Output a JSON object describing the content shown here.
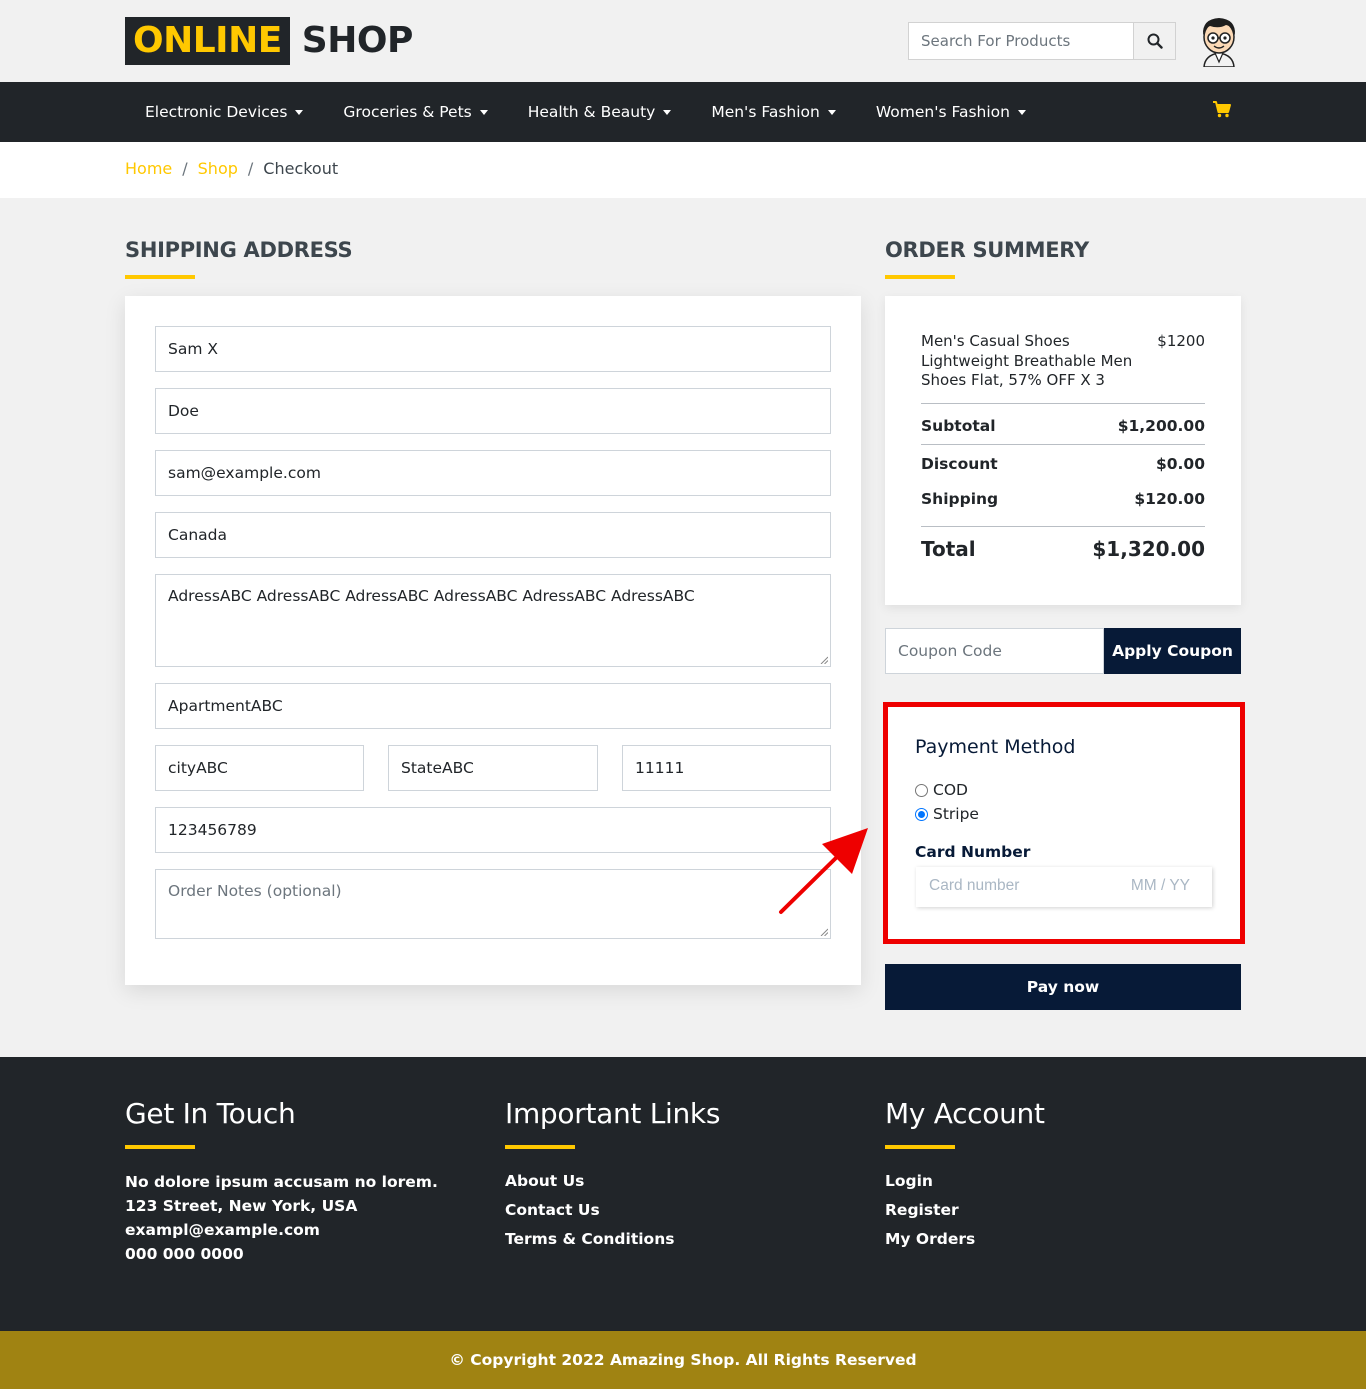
{
  "brand": {
    "part1": "ONLINE",
    "part2": "SHOP"
  },
  "search": {
    "placeholder": "Search For Products",
    "icon": "search-icon"
  },
  "nav": {
    "items": [
      {
        "label": "Electronic Devices"
      },
      {
        "label": "Groceries & Pets"
      },
      {
        "label": "Health & Beauty"
      },
      {
        "label": "Men's Fashion"
      },
      {
        "label": "Women's Fashion"
      }
    ],
    "cart_icon": "cart-icon",
    "accent_color": "#ffc800"
  },
  "breadcrumb": {
    "home": "Home",
    "shop": "Shop",
    "current": "Checkout",
    "sep": "/"
  },
  "shipping": {
    "title": "SHIPPING ADDRESS",
    "first_name": "Sam X",
    "last_name": "Doe",
    "email": "sam@example.com",
    "country": "Canada",
    "address": "AdressABC AdressABC AdressABC AdressABC AdressABC AdressABC",
    "apartment": "ApartmentABC",
    "city": "cityABC",
    "state": "StateABC",
    "zip": "11111",
    "phone": "123456789",
    "notes_placeholder": "Order Notes (optional)"
  },
  "summary": {
    "title": "ORDER SUMMERY",
    "item_name": "Men's Casual Shoes Lightweight Breathable Men Shoes Flat, 57% OFF X 3",
    "item_price": "$1200",
    "subtotal_label": "Subtotal",
    "subtotal_value": "$1,200.00",
    "discount_label": "Discount",
    "discount_value": "$0.00",
    "shipping_label": "Shipping",
    "shipping_value": "$120.00",
    "total_label": "Total",
    "total_value": "$1,320.00"
  },
  "coupon": {
    "placeholder": "Coupon Code",
    "button": "Apply Coupon"
  },
  "payment": {
    "title": "Payment Method",
    "options": [
      {
        "label": "COD",
        "selected": false
      },
      {
        "label": "Stripe",
        "selected": true
      }
    ],
    "card_label": "Card Number",
    "card_placeholder": "Card number",
    "expiry_placeholder": "MM / YY",
    "highlight_color": "#ee0000",
    "pay_button": "Pay now"
  },
  "footer": {
    "contact": {
      "title": "Get In Touch",
      "line1": "No dolore ipsum accusam no lorem.",
      "line2": "123 Street, New York, USA",
      "line3": "exampl@example.com",
      "line4": "000 000 0000"
    },
    "links": {
      "title": "Important Links",
      "items": [
        "About Us",
        "Contact Us",
        "Terms & Conditions"
      ]
    },
    "account": {
      "title": "My Account",
      "items": [
        "Login",
        "Register",
        "My Orders"
      ]
    },
    "copyright": "© Copyright 2022 Amazing Shop. All Rights Reserved"
  }
}
